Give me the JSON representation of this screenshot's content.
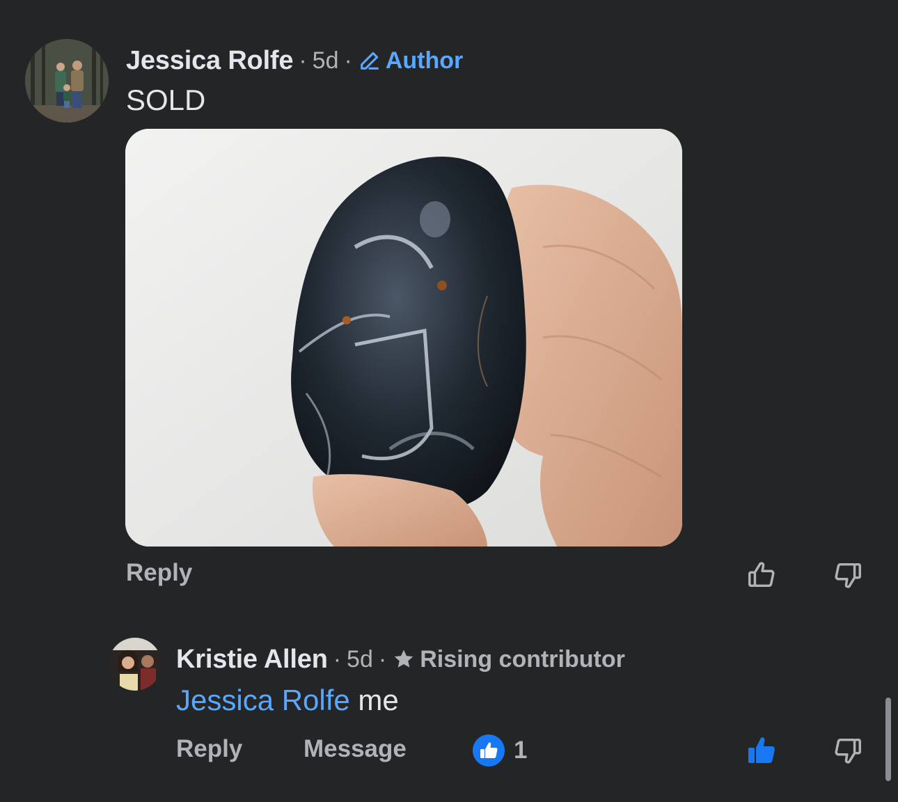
{
  "comments": [
    {
      "author": "Jessica Rolfe",
      "separator": "·",
      "time": "5d",
      "badge_label": "Author",
      "text": "SOLD",
      "actions": {
        "reply": "Reply"
      }
    },
    {
      "author": "Kristie Allen",
      "separator": "·",
      "time": "5d",
      "badge_label": "Rising contributor",
      "mention": "Jessica Rolfe",
      "text": " me",
      "actions": {
        "reply": "Reply",
        "message": "Message"
      },
      "reaction_count": "1"
    }
  ],
  "colors": {
    "background": "#242527",
    "accent": "#5aa7ff",
    "like_active": "#1877f2",
    "muted": "#b0b3b8"
  },
  "icons": [
    "pencil-icon",
    "star-icon",
    "thumbs-up-icon",
    "thumbs-down-icon",
    "like-reaction-icon"
  ]
}
